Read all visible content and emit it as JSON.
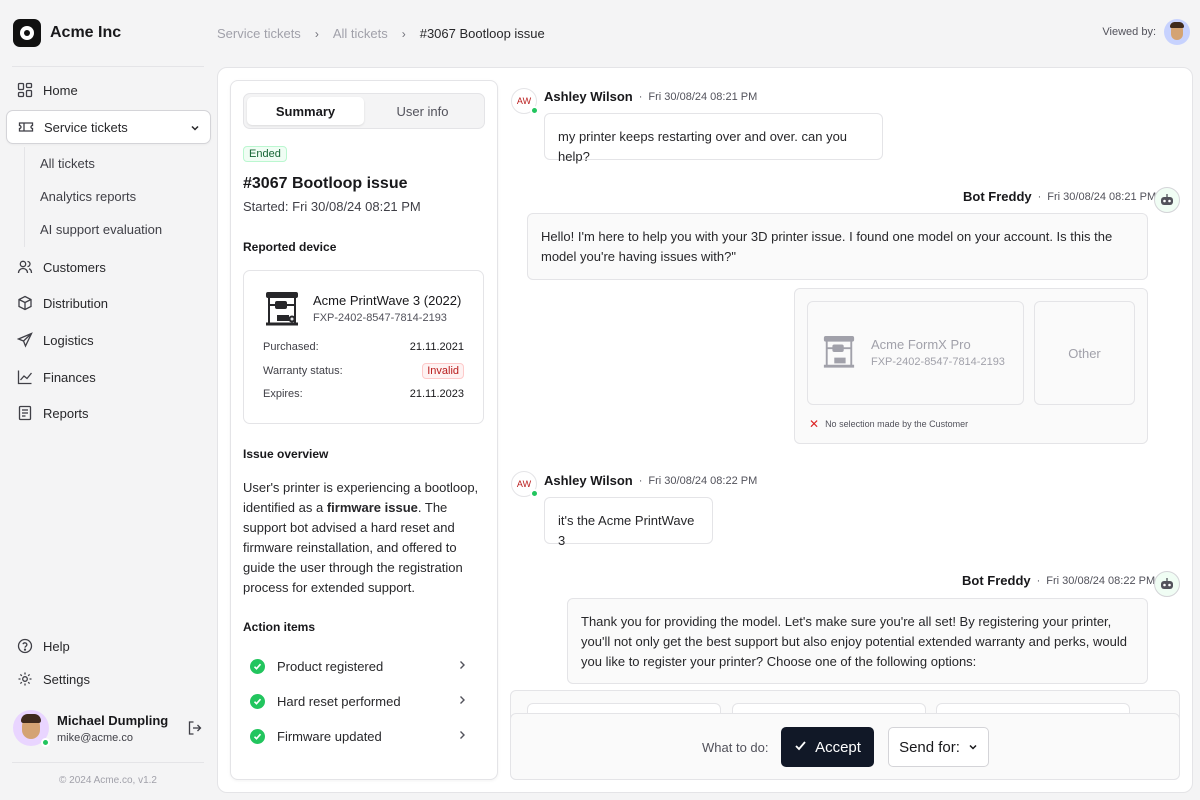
{
  "brand": {
    "name": "Acme Inc"
  },
  "nav": {
    "home": "Home",
    "service_tickets": "Service tickets",
    "sub": [
      "All tickets",
      "Analytics reports",
      "AI support evaluation"
    ],
    "customers": "Customers",
    "distribution": "Distribution",
    "logistics": "Logistics",
    "finances": "Finances",
    "reports": "Reports",
    "help": "Help",
    "settings": "Settings"
  },
  "user": {
    "name": "Michael Dumpling",
    "email": "mike@acme.co"
  },
  "copyright": "© 2024 Acme.co, v1.2",
  "breadcrumb": [
    "Service tickets",
    "All tickets",
    "#3067 Bootloop issue"
  ],
  "viewed_by": "Viewed by:",
  "tabs": {
    "summary": "Summary",
    "user_info": "User info"
  },
  "ticket": {
    "status": "Ended",
    "title": "#3067 Bootloop issue",
    "started": "Started: Fri 30/08/24 08:21 PM"
  },
  "device": {
    "heading": "Reported device",
    "name": "Acme PrintWave 3 (2022)",
    "serial": "FXP-2402-8547-7814-2193",
    "purchased_label": "Purchased:",
    "purchased": "21.11.2021",
    "warranty_label": "Warranty status:",
    "warranty": "Invalid",
    "expires_label": "Expires:",
    "expires": "21.11.2023"
  },
  "issue": {
    "heading": "Issue overview",
    "text_before": "User's printer is experiencing a bootloop, identified as a ",
    "text_bold": "firmware issue",
    "text_after": ". The support bot advised a hard reset and firmware reinstallation, and offered to guide the user through the registration process for extended support."
  },
  "actions": {
    "heading": "Action items",
    "items": [
      "Product registered",
      "Hard reset performed",
      "Firmware updated"
    ]
  },
  "chat": {
    "m1": {
      "initials": "AW",
      "name": "Ashley Wilson",
      "time": "Fri 30/08/24 08:21 PM",
      "text": "my printer keeps restarting over and over. can you help?"
    },
    "m2": {
      "name": "Bot Freddy",
      "time": "Fri 30/08/24 08:21 PM",
      "text": "Hello! I'm here to help you with your 3D printer issue. I found one model on your account. Is this the model you're having issues with?\""
    },
    "choice": {
      "name": "Acme FormX Pro",
      "serial": "FXP-2402-8547-7814-2193",
      "other": "Other",
      "no_selection": "No selection made by the Customer"
    },
    "m3": {
      "initials": "AW",
      "name": "Ashley Wilson",
      "time": "Fri 30/08/24 08:22 PM",
      "text": "it's the Acme PrintWave 3"
    },
    "m4": {
      "name": "Bot Freddy",
      "time": "Fri 30/08/24 08:22 PM",
      "text": "Thank you for providing the model. Let's make sure you're all set! By registering your printer, you'll not only get the best support but also enjoy potential extended warranty and perks, would you like to register your printer? Choose one of the following options:"
    }
  },
  "action_bar": {
    "label": "What to do:",
    "accept": "Accept",
    "send_for": "Send for:"
  }
}
